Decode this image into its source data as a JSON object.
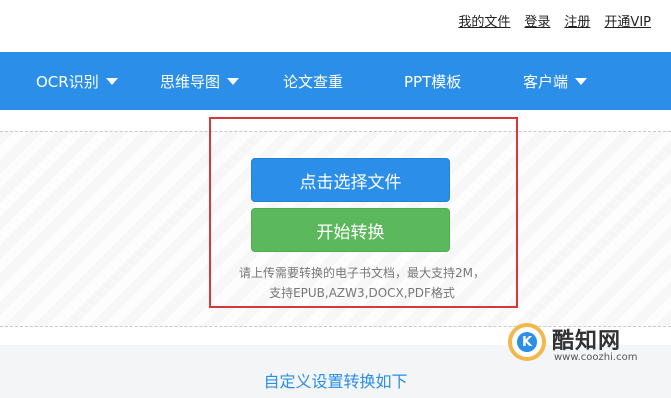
{
  "top_links": [
    "我的文件",
    "登录",
    "注册",
    "开通VIP"
  ],
  "nav": [
    {
      "label": "OCR识别",
      "dropdown": true
    },
    {
      "label": "思维导图",
      "dropdown": true
    },
    {
      "label": "论文查重",
      "dropdown": false
    },
    {
      "label": "PPT模板",
      "dropdown": false
    },
    {
      "label": "客户端",
      "dropdown": true
    }
  ],
  "upload": {
    "select_button": "点击选择文件",
    "convert_button": "开始转换",
    "hint_line1": "请上传需要转换的电子书文档，最大支持2M，",
    "hint_line2": "支持EPUB,AZW3,DOCX,PDF格式"
  },
  "section_title": "自定义设置转换如下",
  "watermark": {
    "name": "酷知网",
    "url": "www.coozhi.com"
  },
  "colors": {
    "primary": "#2b8ee8",
    "success": "#5cb85c",
    "highlight_border": "#d9383a"
  }
}
